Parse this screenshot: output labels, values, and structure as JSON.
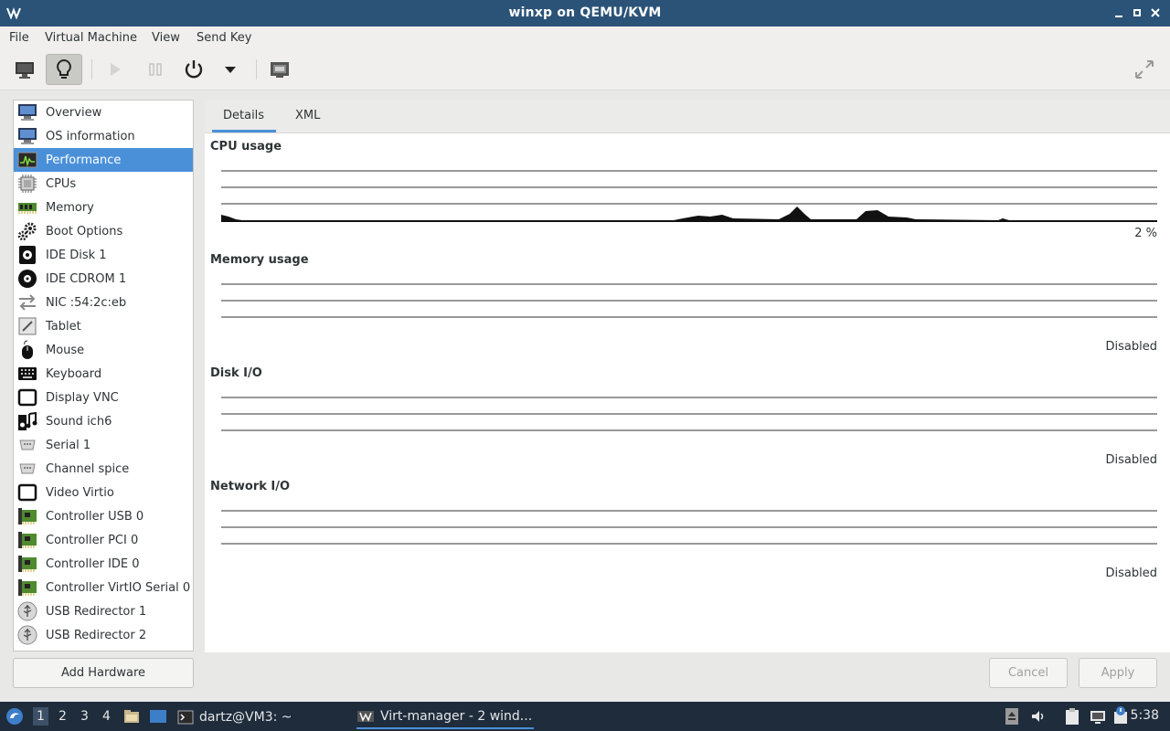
{
  "window": {
    "title": "winxp on QEMU/KVM"
  },
  "menubar": {
    "items": [
      "File",
      "Virtual Machine",
      "View",
      "Send Key"
    ]
  },
  "sidebar": {
    "items": [
      {
        "label": "Overview",
        "icon": "monitor-icon"
      },
      {
        "label": "OS information",
        "icon": "monitor-icon"
      },
      {
        "label": "Performance",
        "icon": "performance-icon"
      },
      {
        "label": "CPUs",
        "icon": "cpu-icon"
      },
      {
        "label": "Memory",
        "icon": "memory-icon"
      },
      {
        "label": "Boot Options",
        "icon": "gears-icon"
      },
      {
        "label": "IDE Disk 1",
        "icon": "disk-icon"
      },
      {
        "label": "IDE CDROM 1",
        "icon": "cdrom-icon"
      },
      {
        "label": "NIC :54:2c:eb",
        "icon": "network-arrows-icon"
      },
      {
        "label": "Tablet",
        "icon": "tablet-icon"
      },
      {
        "label": "Mouse",
        "icon": "mouse-icon"
      },
      {
        "label": "Keyboard",
        "icon": "keyboard-icon"
      },
      {
        "label": "Display VNC",
        "icon": "display-icon"
      },
      {
        "label": "Sound ich6",
        "icon": "sound-icon"
      },
      {
        "label": "Serial 1",
        "icon": "serial-icon"
      },
      {
        "label": "Channel spice",
        "icon": "channel-icon"
      },
      {
        "label": "Video Virtio",
        "icon": "video-icon"
      },
      {
        "label": "Controller USB 0",
        "icon": "controller-icon"
      },
      {
        "label": "Controller PCI 0",
        "icon": "controller-icon"
      },
      {
        "label": "Controller IDE 0",
        "icon": "controller-icon"
      },
      {
        "label": "Controller VirtIO Serial 0",
        "icon": "controller-icon"
      },
      {
        "label": "USB Redirector 1",
        "icon": "usb-icon"
      },
      {
        "label": "USB Redirector 2",
        "icon": "usb-icon"
      }
    ],
    "selected_index": 2,
    "add_hardware_label": "Add Hardware"
  },
  "tabs": [
    "Details",
    "XML"
  ],
  "sections": {
    "cpu": {
      "title": "CPU usage",
      "value": "2 %"
    },
    "memory": {
      "title": "Memory usage",
      "value": "Disabled"
    },
    "disk": {
      "title": "Disk I/O",
      "value": "Disabled"
    },
    "network": {
      "title": "Network I/O",
      "value": "Disabled"
    }
  },
  "footer": {
    "cancel_label": "Cancel",
    "apply_label": "Apply"
  },
  "taskbar": {
    "workspaces": [
      "1",
      "2",
      "3",
      "4"
    ],
    "terminal_task": "dartz@VM3: ~",
    "active_task": "Virt-manager - 2 wind...",
    "clock": "5:38"
  },
  "colors": {
    "titlebar": "#2b5378",
    "selection": "#4a90d9",
    "taskbar": "#1e2c3c"
  }
}
